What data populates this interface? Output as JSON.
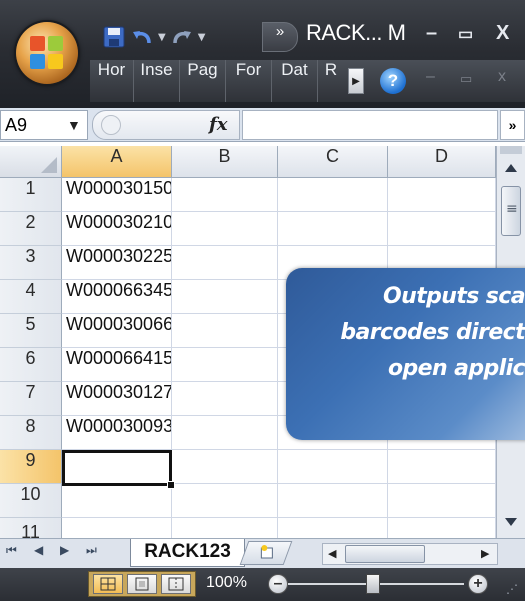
{
  "window": {
    "title": "RACK... M",
    "overflow_chevrons": "»",
    "minimize": "–",
    "restore": "▭",
    "close": "X"
  },
  "ribbon": {
    "tabs": [
      "Hor",
      "Inse",
      "Pag",
      "For",
      "Dat",
      "R"
    ],
    "help": "?",
    "min": "–",
    "restore": "▭",
    "close": "x"
  },
  "formula_bar": {
    "name_box": "A9",
    "fx": "fx",
    "formula_value": "",
    "expand": "»"
  },
  "grid": {
    "columns": [
      "A",
      "B",
      "C",
      "D"
    ],
    "rows": [
      "1",
      "2",
      "3",
      "4",
      "5",
      "6",
      "7",
      "8",
      "9",
      "10",
      "11"
    ],
    "cells_a": [
      "W000030150",
      "W000030210",
      "W000030225",
      "W000066345",
      "W000030066",
      "W000066415",
      "W000030127",
      "W000030093",
      "",
      "",
      ""
    ],
    "active_cell": "A9"
  },
  "sheet_tabs": {
    "active": "RACK123"
  },
  "status_bar": {
    "zoom": "100%",
    "zoom_minus": "–",
    "zoom_plus": "+"
  },
  "callout": {
    "lines": [
      "Outputs sca",
      "barcodes direct",
      "open applic"
    ]
  },
  "colors": {
    "title_bar": "#2f3238",
    "selected_header": "#f4c46a",
    "callout": "#3c70b4"
  }
}
